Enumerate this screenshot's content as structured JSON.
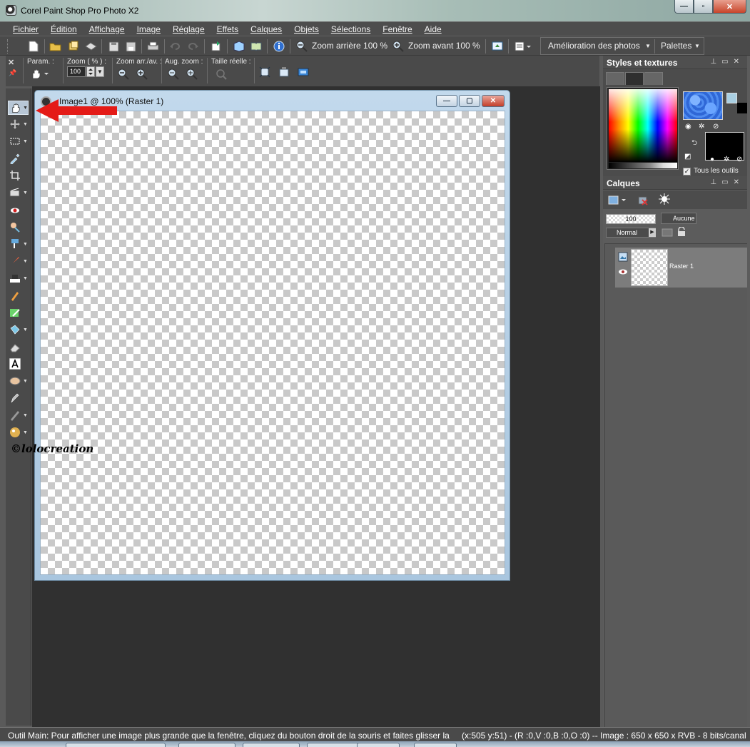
{
  "window": {
    "title": "Corel Paint Shop Pro Photo X2",
    "controls": [
      "minimize",
      "maximize",
      "close"
    ]
  },
  "menu": [
    "Fichier",
    "Édition",
    "Affichage",
    "Image",
    "Réglage",
    "Effets",
    "Calques",
    "Objets",
    "Sélections",
    "Fenêtre",
    "Aide"
  ],
  "toolbar": {
    "zoom_out_label": "Zoom arrière 100 %",
    "zoom_in_label": "Zoom avant 100 %",
    "photo_enhance_label": "Amélioration des photos",
    "palettes_label": "Palettes"
  },
  "options": {
    "presets_label": "Param. :",
    "zoom_pct_label": "Zoom ( % ) :",
    "zoom_value": "100",
    "zoom_out_in_label": "Zoom arr./av. :",
    "aug_zoom_label": "Aug. zoom :",
    "actual_size_label": "Taille réelle :"
  },
  "tools": [
    "pan-tool",
    "move-tool",
    "selection-tool",
    "dropper-tool",
    "crop-tool",
    "straighten-tool",
    "red-eye-tool",
    "makeover-tool",
    "clone-tool",
    "paint-brush-tool",
    "dodge-tool",
    "eraser-gradient-tool",
    "color-replacer-tool",
    "fill-tool",
    "background-eraser-tool",
    "text-tool",
    "shape-tool",
    "pen-tool",
    "warp-brush-tool",
    "picture-tube-tool"
  ],
  "watermark": "©lolocreation",
  "image_window": {
    "title": "Image1 @ 100% (Raster 1)"
  },
  "styles_panel": {
    "title": "Styles et textures",
    "all_tools_label": "Tous les outils",
    "all_tools_checked": true,
    "foreground_color": "#3f78e0",
    "background_color": "#000000"
  },
  "layers_panel": {
    "title": "Calques",
    "opacity": "100",
    "mask_label": "Aucune",
    "blend_mode": "Normal",
    "layers": [
      {
        "name": "Raster 1"
      }
    ]
  },
  "status": {
    "message": "Outil Main: Pour afficher une image plus grande que la fenêtre, cliquez du bouton droit de la souris et faites glisser la s",
    "info": "(x:505 y:51) - (R :0,V :0,B :0,O :0) -- Image :  650 x 650 x RVB - 8 bits/canal"
  },
  "colors": {
    "accent_arrow": "#e41b17",
    "workspace": "#303030",
    "panel": "#4a4a4a"
  }
}
